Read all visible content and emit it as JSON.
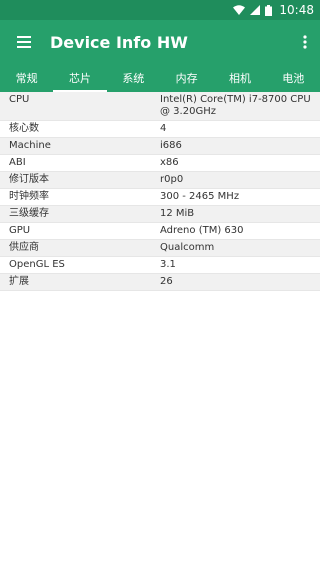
{
  "status_bar": {
    "time": "10:48"
  },
  "app_bar": {
    "title": "Device Info HW"
  },
  "tabs": [
    {
      "label": "常规",
      "active": false
    },
    {
      "label": "芯片",
      "active": true
    },
    {
      "label": "系统",
      "active": false
    },
    {
      "label": "内存",
      "active": false
    },
    {
      "label": "相机",
      "active": false
    },
    {
      "label": "电池",
      "active": false
    }
  ],
  "rows": [
    {
      "label": "CPU",
      "value": "Intel(R) Core(TM) i7-8700 CPU @ 3.20GHz"
    },
    {
      "label": "核心数",
      "value": "4"
    },
    {
      "label": "Machine",
      "value": "i686"
    },
    {
      "label": "ABI",
      "value": "x86"
    },
    {
      "label": "修订版本",
      "value": "r0p0"
    },
    {
      "label": "时钟频率",
      "value": "300 - 2465 MHz"
    },
    {
      "label": "三级缓存",
      "value": "12 MiB"
    },
    {
      "label": "GPU",
      "value": "Adreno (TM) 630"
    },
    {
      "label": "供应商",
      "value": "Qualcomm"
    },
    {
      "label": "OpenGL ES",
      "value": "3.1"
    },
    {
      "label": "扩展",
      "value": "26"
    }
  ]
}
